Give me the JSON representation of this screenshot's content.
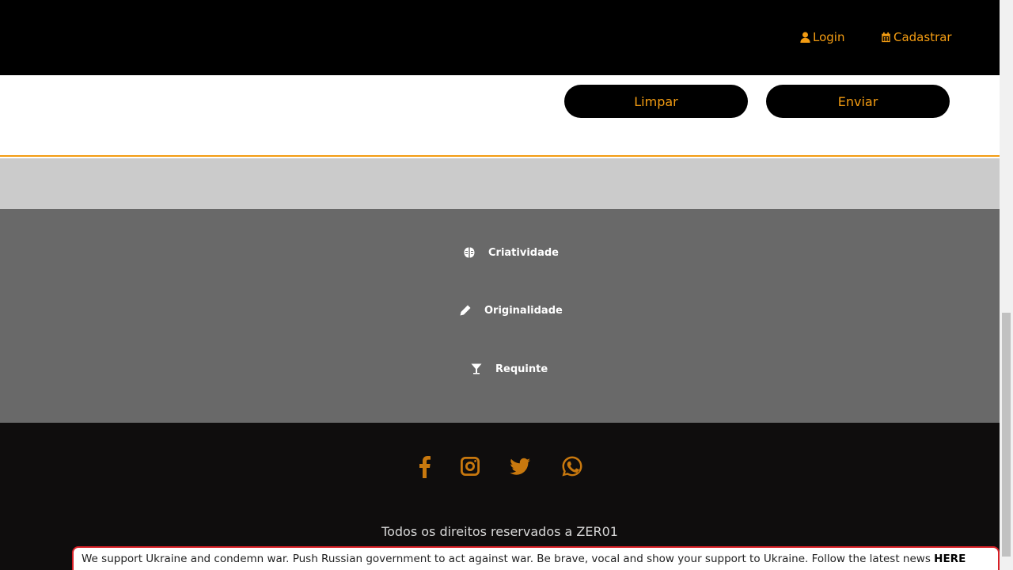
{
  "nav": {
    "login_label": "Login",
    "register_label": "Cadastrar"
  },
  "form": {
    "clear_label": "Limpar",
    "send_label": "Enviar"
  },
  "features": [
    {
      "label": "Criatividade",
      "icon": "brain-icon"
    },
    {
      "label": "Originalidade",
      "icon": "pencil-icon"
    },
    {
      "label": "Requinte",
      "icon": "cocktail-icon"
    }
  ],
  "footer": {
    "social": [
      "facebook-icon",
      "instagram-icon",
      "twitter-icon",
      "whatsapp-icon"
    ],
    "rights": "Todos os direitos reservados a ZER01"
  },
  "banner": {
    "text": "We support Ukraine and condemn war. Push Russian government to act against war. Be brave, vocal and show your support to Ukraine. Follow the latest news ",
    "link": "HERE"
  },
  "colors": {
    "accent": "#f39c12",
    "topbar": "#000000",
    "features_bg": "#696969",
    "footer_bg": "#0f0d0d",
    "banner_border": "#d71f26"
  }
}
